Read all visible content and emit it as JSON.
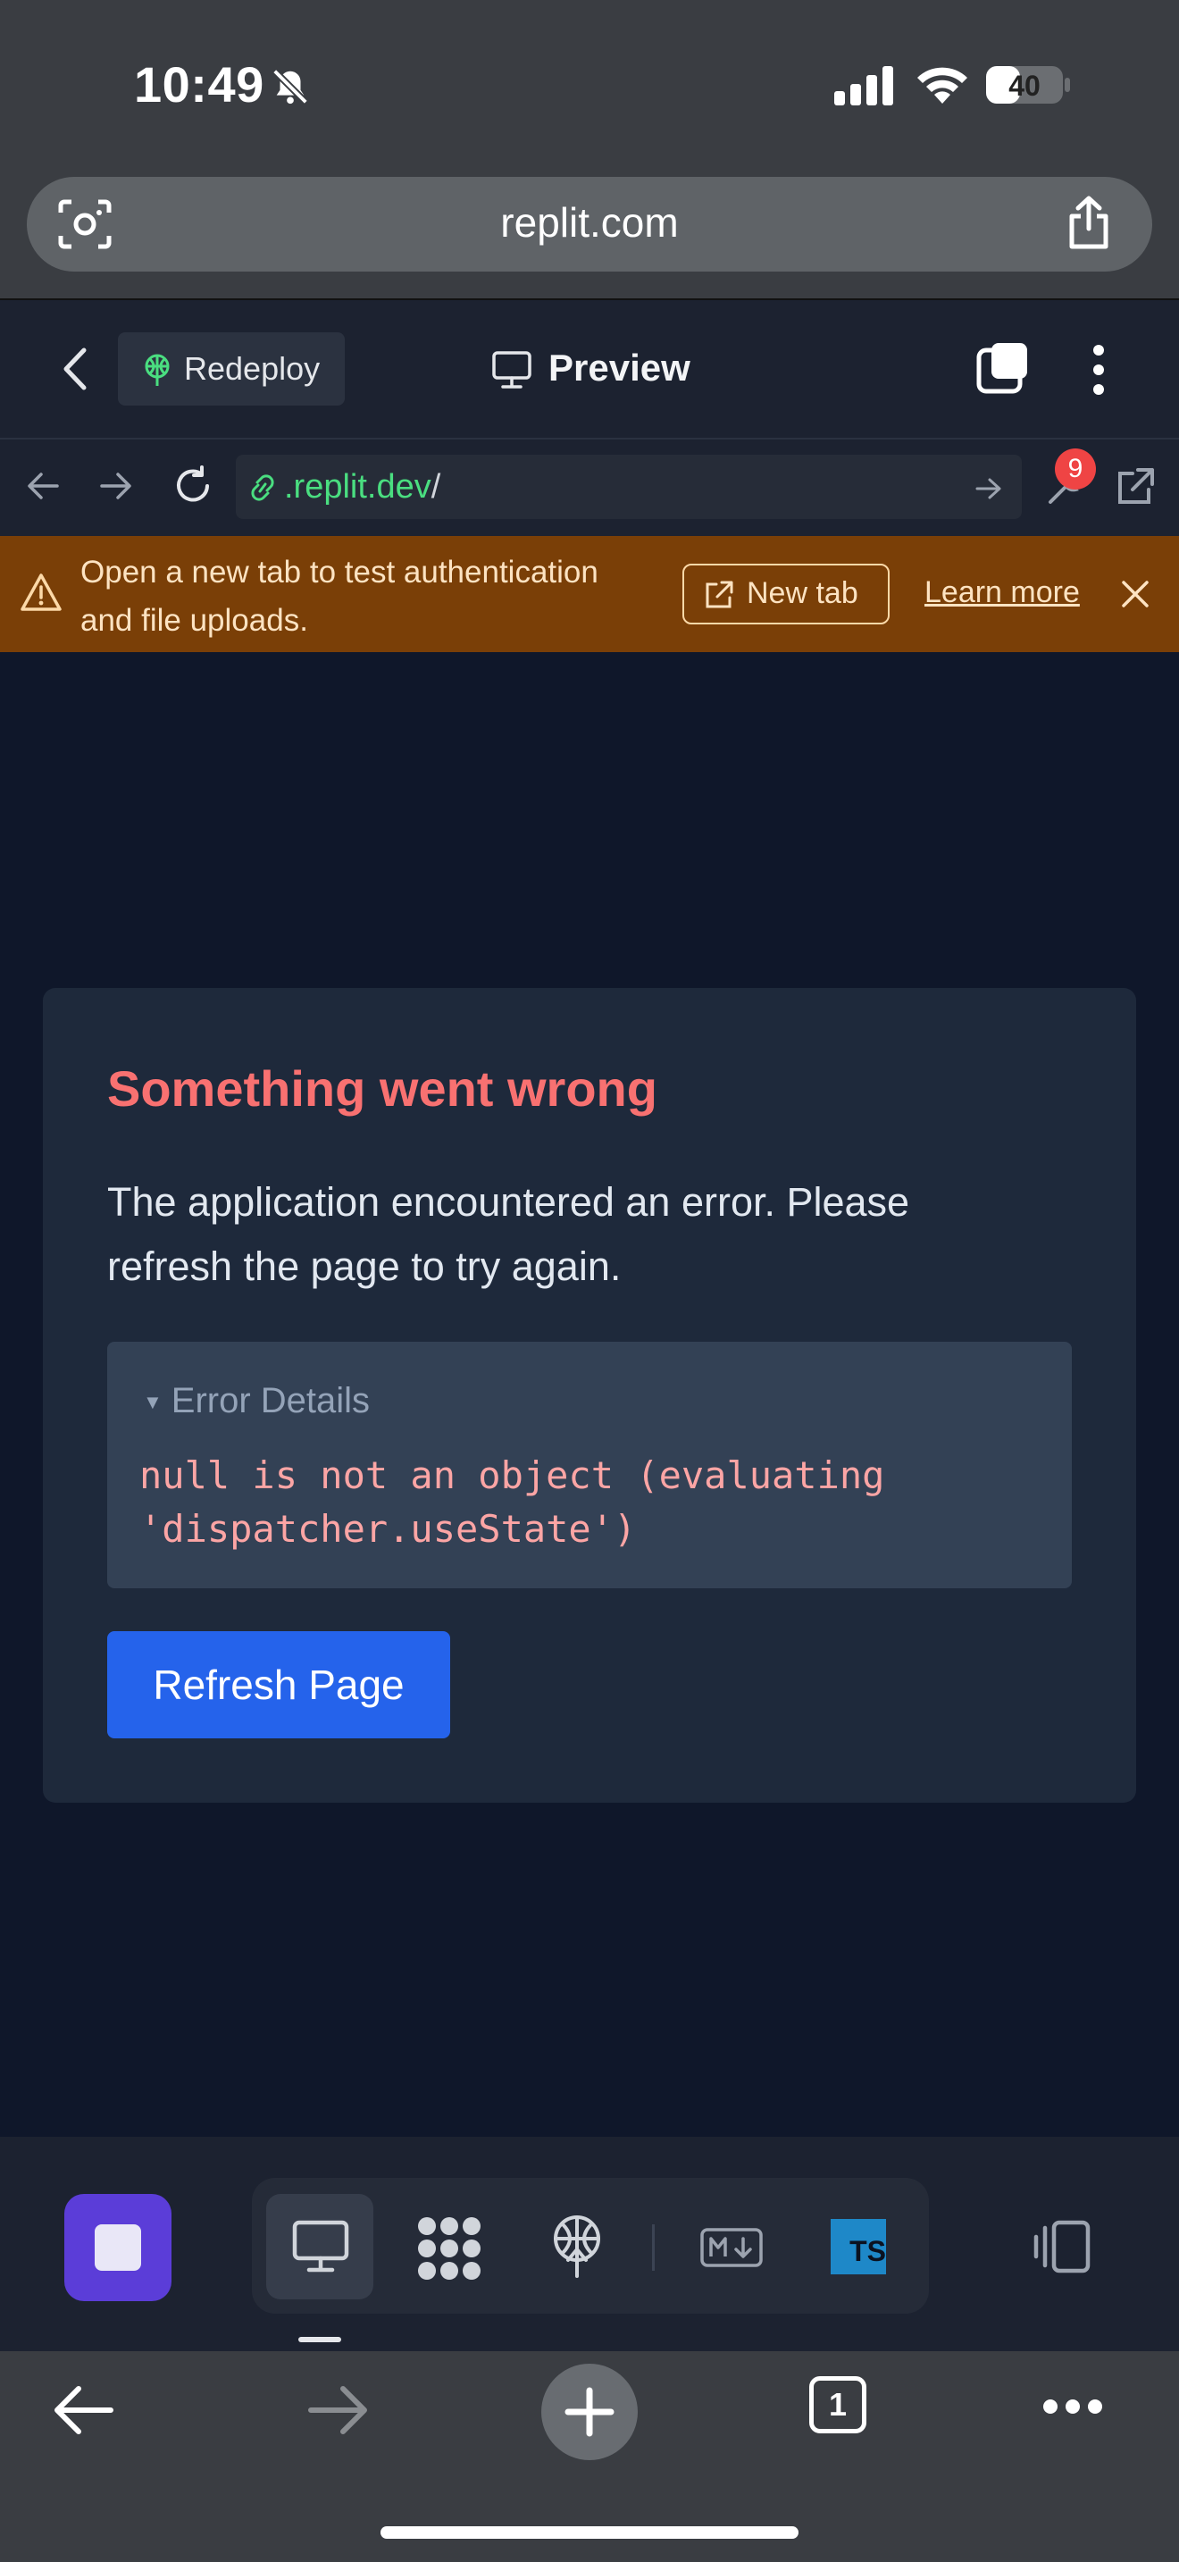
{
  "status_bar": {
    "time": "10:49",
    "battery": "40"
  },
  "browser": {
    "address": "replit.com"
  },
  "replit_header": {
    "redeploy_label": "Redeploy",
    "preview_label": "Preview"
  },
  "nav": {
    "url_domain": ".replit.dev",
    "url_path": "/",
    "badge_count": "9"
  },
  "banner": {
    "message": "Open a new tab to test authentication and file uploads.",
    "new_tab_label": "New tab",
    "learn_more_label": "Learn more"
  },
  "error_card": {
    "title": "Something went wrong",
    "message": "The application encountered an error. Please refresh the page to try again.",
    "details_summary": "Error Details",
    "details_code": "null is not an object (evaluating\n'dispatcher.useState')",
    "refresh_label": "Refresh Page"
  },
  "tool_bar": {
    "ts_label": "TS"
  },
  "safari_bottom": {
    "tab_count": "1"
  },
  "colors": {
    "accent_blue": "#2563eb",
    "error_red": "#f87171",
    "warning_bg": "#7a3f07",
    "url_green": "#4ade80",
    "stop_purple": "#5b3dd8"
  }
}
